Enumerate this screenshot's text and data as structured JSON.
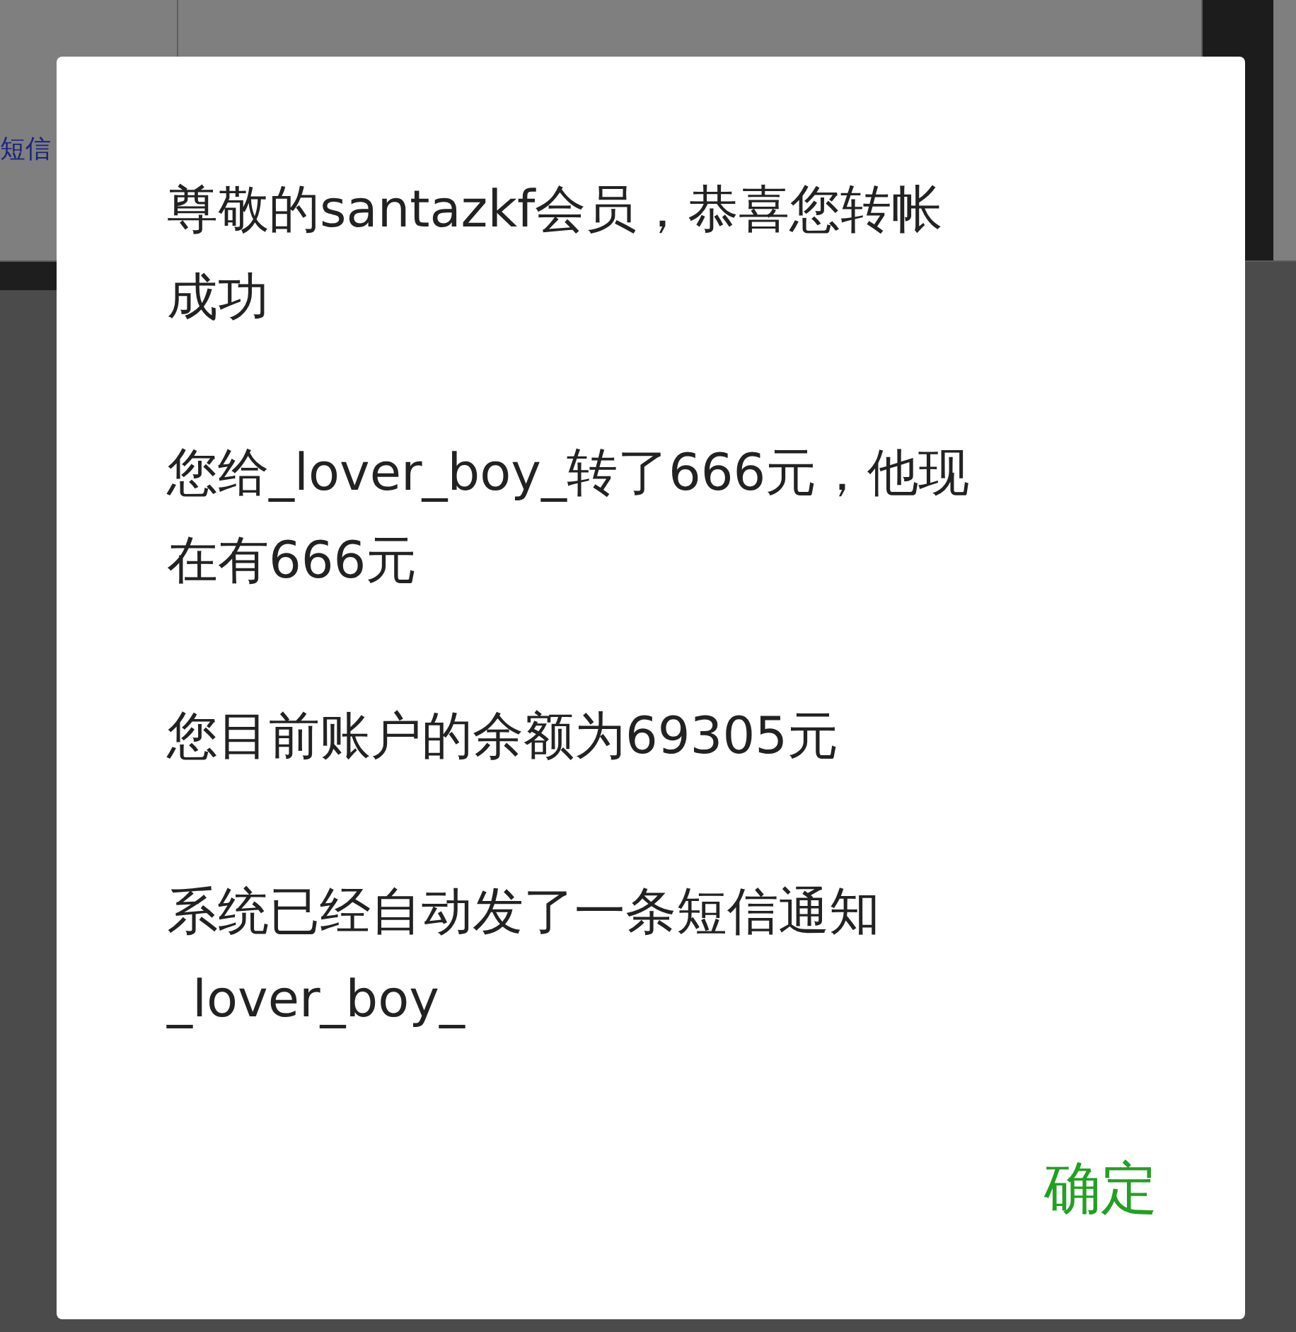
{
  "background": {
    "link": "短信"
  },
  "dialog": {
    "paragraphs": [
      "尊敬的santazkf会员，恭喜您转帐成功",
      "您给_lover_boy_转了666元，他现在有666元",
      "您目前账户的余额为69305元",
      "系统已经自动发了一条短信通知_lover_boy_"
    ],
    "button": "确定"
  }
}
